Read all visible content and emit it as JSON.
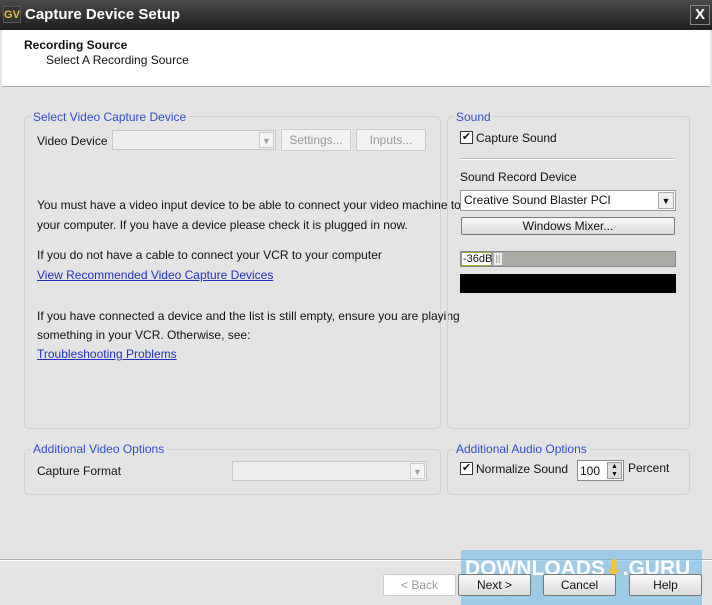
{
  "window": {
    "title": "Capture Device Setup",
    "logo": "GV",
    "close": "X"
  },
  "header": {
    "title": "Recording Source",
    "subtitle": "Select A Recording Source"
  },
  "video": {
    "legend": "Select Video Capture Device",
    "device_label": "Video Device",
    "device_value": "",
    "settings": "Settings...",
    "inputs": "Inputs...",
    "msg1": "You must have a video input device to be able to connect your video machine to",
    "msg2": "your computer. If you have a device please check it is plugged in now.",
    "msg3": "If you do not have a cable to connect your VCR to your computer",
    "link1": "View Recommended Video Capture Devices",
    "msg4": "If you have connected a device and the list is still empty, ensure you are playing",
    "msg5": "something in your VCR. Otherwise, see:",
    "link2": "Troubleshooting Problems"
  },
  "sound": {
    "legend": "Sound",
    "capture_label": "Capture Sound",
    "capture_checked": true,
    "device_label": "Sound Record Device",
    "device_value": "Creative Sound Blaster PCI",
    "mixer": "Windows Mixer...",
    "level": "-36dB"
  },
  "add_video": {
    "legend": "Additional Video Options",
    "format_label": "Capture Format",
    "format_value": ""
  },
  "add_audio": {
    "legend": "Additional Audio Options",
    "normalize_label": "Normalize Sound",
    "normalize_checked": true,
    "percent_value": "100",
    "percent_label": "Percent"
  },
  "footer": {
    "back": "< Back",
    "next": "Next >",
    "cancel": "Cancel",
    "help": "Help"
  },
  "watermark": {
    "text": "DOWNLOADS",
    "suffix": ".GURU"
  }
}
